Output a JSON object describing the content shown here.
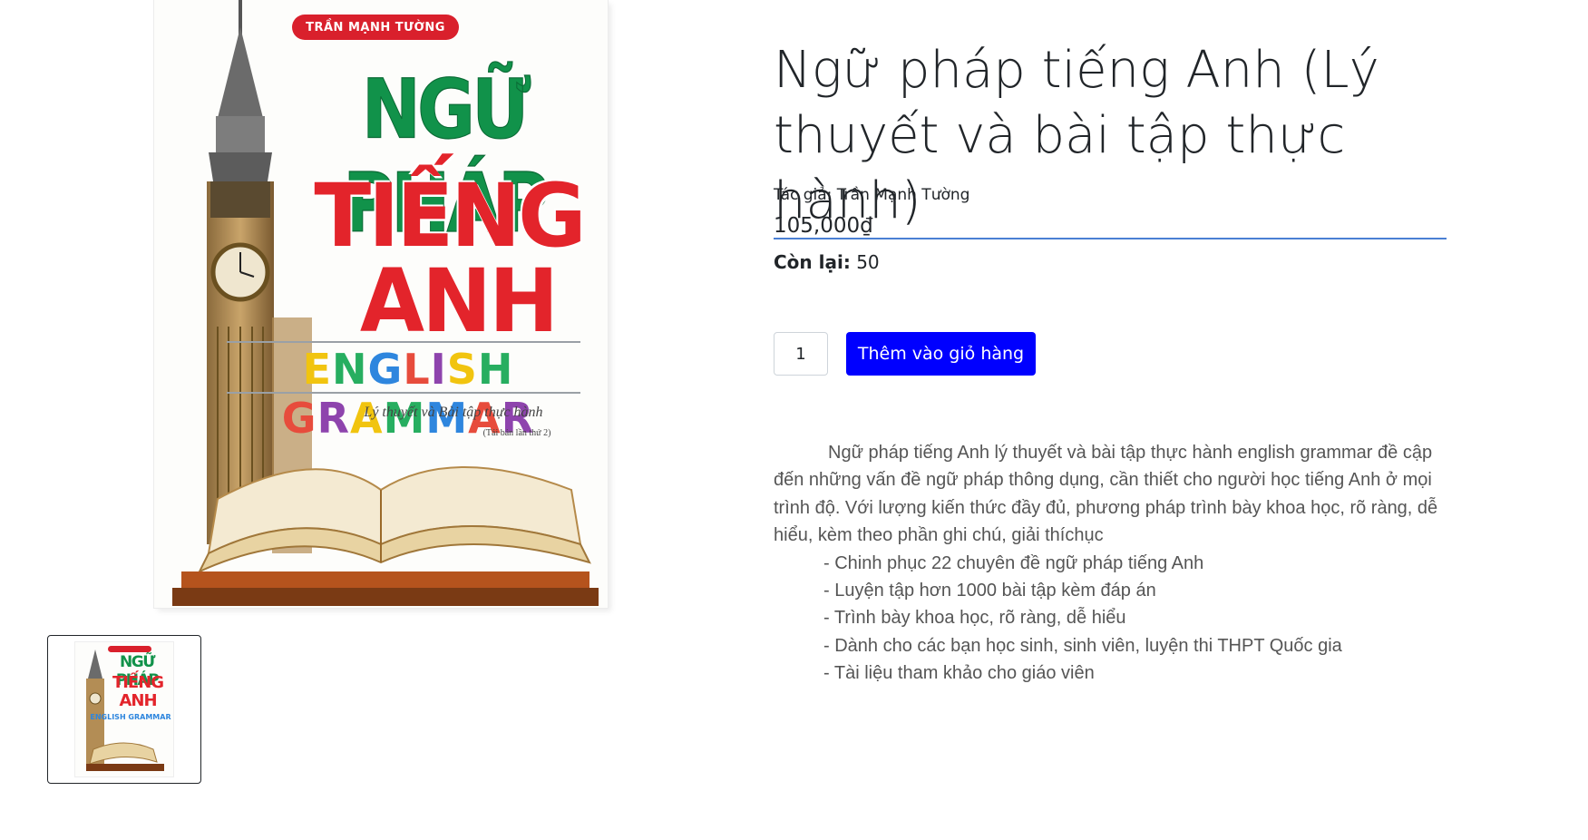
{
  "product": {
    "title": "Ngữ pháp tiếng Anh (Lý thuyết và bài tập thực hành)",
    "author_line": "Tác giả: Trần Mạnh Tường",
    "price": "105,000₫",
    "stock_label": "Còn lại:",
    "stock_value": "50"
  },
  "cart": {
    "quantity": "1",
    "add_button_label": "Thêm vào giỏ hàng"
  },
  "cover": {
    "author": "TRẦN MẠNH TƯỜNG",
    "title_line1": "NGỮ PHÁP",
    "title_line2": "TIẾNG",
    "title_line3": "ANH",
    "english_title": "ENGLISH GRAMMAR",
    "subtitle": "Lý thuyết và Bài tập thực hành",
    "edition": "(Tái bản lần thứ 2)"
  },
  "thumbnail": {
    "title_line1": "NGỮ PHÁP",
    "title_line2": "TIẾNG",
    "title_line3": "ANH",
    "english_title": "ENGLISH GRAMMAR"
  },
  "description": {
    "intro": "Ngữ pháp tiếng Anh lý thuyết và bài tập thực hành english grammar  đề cập đến những vấn đề ngữ pháp thông dụng, cần thiết cho người học tiếng Anh ở mọi trình độ. Với lượng kiến thức đầy đủ, phương pháp trình bày khoa học, rõ ràng, dễ hiểu, kèm theo phần ghi chú, giải thíchục",
    "bullets": [
      "- Chinh phục 22 chuyên đề ngữ pháp tiếng Anh",
      "- Luyện tập hơn 1000 bài tập kèm đáp án",
      "- Trình bày khoa học, rõ ràng, dễ hiểu",
      "- Dành cho các bạn học sinh, sinh viên, luyện thi THPT Quốc gia",
      "- Tài liệu tham khảo cho giáo viên"
    ]
  },
  "colors": {
    "button": "#0000ff",
    "title_underline": "#4a7fd4",
    "cover_green": "#11924a",
    "cover_red": "#e3242b"
  }
}
